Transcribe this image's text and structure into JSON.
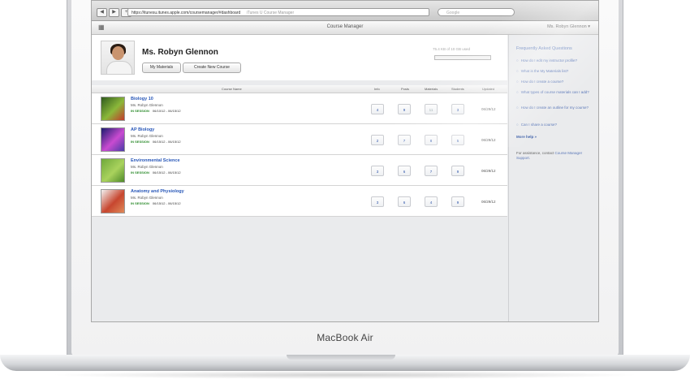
{
  "device": {
    "brand_label": "MacBook Air"
  },
  "browser": {
    "url": "https://itunesu.itunes.apple.com/coursemanager/#dashboard",
    "tab_title": "iTunes U Course Manager",
    "search_placeholder": "Google",
    "back_glyph": "◀",
    "forward_glyph": "▶",
    "add_glyph": "+"
  },
  "app": {
    "title": "Course Manager",
    "user_menu": "Ms. Robyn Glennon ▾"
  },
  "profile": {
    "name": "Ms. Robyn Glennon",
    "my_materials_label": "My Materials",
    "create_course_label": "Create New Course",
    "storage_text": "75.4 KB of 10 GB used"
  },
  "table": {
    "headers": {
      "name": "Course Name",
      "info": "Info",
      "posts": "Posts",
      "materials": "Materials",
      "students": "Students",
      "updated": "Updated"
    },
    "rows": [
      {
        "name": "Biology 10",
        "instructor": "Ms. Robyn Glennon",
        "status": "IN SESSION",
        "dates": "06/10/12 - 06/15/12",
        "info": "4",
        "posts": "9",
        "materials": "11",
        "students": "3",
        "updated": "06/29/12",
        "thumb_colors": [
          "#2f5a1d",
          "#8bb83a",
          "#c33a2b"
        ]
      },
      {
        "name": "AP Biology",
        "instructor": "Ms. Robyn Glennon",
        "status": "IN SESSION",
        "dates": "06/15/12 - 06/15/12",
        "info": "2",
        "posts": "7",
        "materials": "8",
        "students": "5",
        "updated": "06/29/12",
        "thumb_colors": [
          "#1b1c6e",
          "#c94bd1",
          "#4a3aa6"
        ]
      },
      {
        "name": "Environmental Science",
        "instructor": "Ms. Robyn Glennon",
        "status": "IN SESSION",
        "dates": "06/15/12 - 06/15/12",
        "info": "3",
        "posts": "6",
        "materials": "7",
        "students": "9",
        "updated": "06/29/12",
        "thumb_colors": [
          "#6fa83a",
          "#a9d25d",
          "#4f8a2a"
        ]
      },
      {
        "name": "Anatomy and Physiology",
        "instructor": "Ms. Robyn Glennon",
        "status": "IN SESSION",
        "dates": "06/15/12 - 06/15/12",
        "info": "3",
        "posts": "6",
        "materials": "4",
        "students": "9",
        "updated": "06/29/12",
        "thumb_colors": [
          "#f2f2f2",
          "#c7462f",
          "#e08a5a"
        ]
      }
    ]
  },
  "faq": {
    "heading": "Frequently Asked Questions",
    "questions": [
      "How do I edit my instructor profile?",
      "What is the My Materials list?",
      "How do I create a course?",
      "What types of course materials can I add?",
      "How do I create an outline for my course?",
      "Can I share a course?"
    ],
    "more_help": "More help »",
    "assistance_prefix": "For assistance, contact",
    "assistance_link": "Course Manager Support."
  }
}
